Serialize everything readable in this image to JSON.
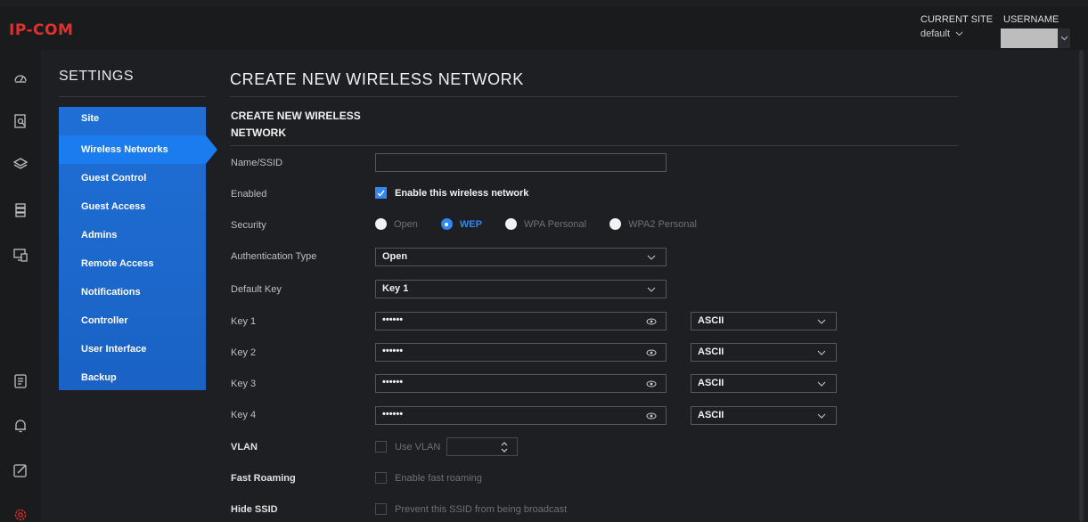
{
  "brand": {
    "logo_text": "IP-COM",
    "accent": "#e0302e",
    "primary": "#1f6fd6",
    "selected_blue": "#2f88f5"
  },
  "header": {
    "site_label": "CURRENT SITE",
    "site_value": "default",
    "user_label": "USERNAME"
  },
  "rail": [
    "dashboard-icon",
    "statistics-icon",
    "layers-icon",
    "devices-icon",
    "clients-icon",
    "logs-icon",
    "alerts-icon",
    "edit-icon",
    "settings-icon"
  ],
  "settings": {
    "title": "SETTINGS",
    "items": [
      {
        "label": "Site"
      },
      {
        "label": "Wireless Networks"
      },
      {
        "label": "Guest Control"
      },
      {
        "label": "Guest Access"
      },
      {
        "label": "Admins"
      },
      {
        "label": "Remote Access"
      },
      {
        "label": "Notifications"
      },
      {
        "label": "Controller"
      },
      {
        "label": "User Interface"
      },
      {
        "label": "Backup"
      }
    ],
    "active_index": 1
  },
  "page": {
    "title": "CREATE NEW WIRELESS NETWORK",
    "section_title": "CREATE NEW WIRELESS NETWORK"
  },
  "form": {
    "name_label": "Name/SSID",
    "name_value": "",
    "enabled_label": "Enabled",
    "enabled_text": "Enable this wireless network",
    "security_label": "Security",
    "security_options": [
      "Open",
      "WEP",
      "WPA Personal",
      "WPA2 Personal"
    ],
    "security_selected": "WEP",
    "auth_label": "Authentication Type",
    "auth_value": "Open",
    "default_key_label": "Default Key",
    "default_key_value": "Key 1",
    "keys": [
      {
        "label": "Key 1",
        "value": "••••••",
        "format": "ASCII"
      },
      {
        "label": "Key 2",
        "value": "••••••",
        "format": "ASCII"
      },
      {
        "label": "Key 3",
        "value": "••••••",
        "format": "ASCII"
      },
      {
        "label": "Key 4",
        "value": "••••••",
        "format": "ASCII"
      }
    ],
    "vlan_label": "VLAN",
    "vlan_text": "Use VLAN",
    "fast_roaming_label": "Fast Roaming",
    "fast_roaming_text": "Enable fast roaming",
    "hide_ssid_label": "Hide SSID",
    "hide_ssid_text": "Prevent this SSID from being broadcast"
  }
}
